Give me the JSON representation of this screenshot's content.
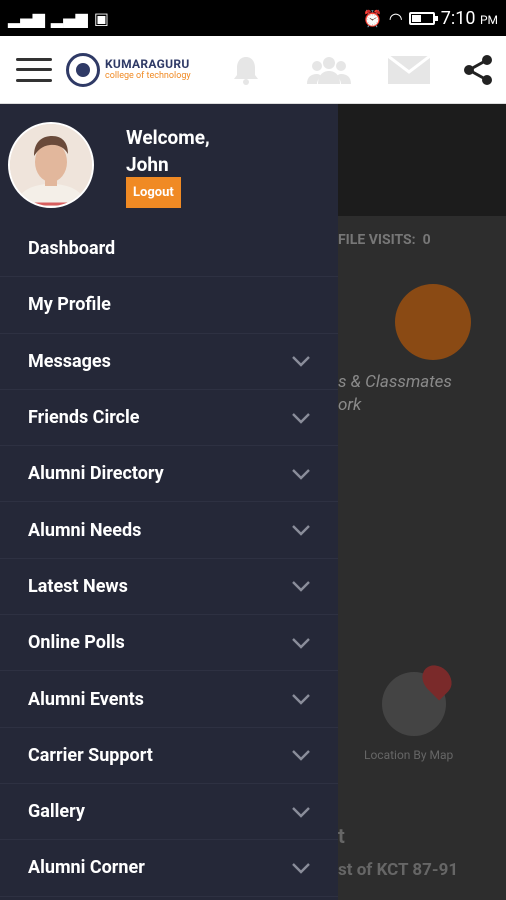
{
  "status": {
    "time": "7:10",
    "ampm": "PM"
  },
  "header": {
    "logo_title": "KUMARAGURU",
    "logo_subtitle": "college of technology"
  },
  "profile": {
    "welcome": "Welcome,",
    "name": "John",
    "logout_label": "Logout"
  },
  "menu": [
    {
      "label": "Dashboard",
      "expandable": false
    },
    {
      "label": "My Profile",
      "expandable": false
    },
    {
      "label": "Messages",
      "expandable": true
    },
    {
      "label": "Friends Circle",
      "expandable": true
    },
    {
      "label": "Alumni Directory",
      "expandable": true
    },
    {
      "label": "Alumni Needs",
      "expandable": true
    },
    {
      "label": "Latest News",
      "expandable": true
    },
    {
      "label": "Online Polls",
      "expandable": true
    },
    {
      "label": "Alumni Events",
      "expandable": true
    },
    {
      "label": "Carrier Support",
      "expandable": true
    },
    {
      "label": "Gallery",
      "expandable": true
    },
    {
      "label": "Alumni Corner",
      "expandable": true
    }
  ],
  "background": {
    "profile_visits_label": "FILE VISITS:",
    "profile_visits_value": "0",
    "classmates_text": "s & Classmates",
    "work_text": "ork",
    "location_label": "Location By Map",
    "footer_title": "t",
    "footer_text": "st of KCT 87-91"
  },
  "colors": {
    "drawer": "#252838",
    "accent": "#f08a24",
    "brand": "#2f3a66"
  }
}
